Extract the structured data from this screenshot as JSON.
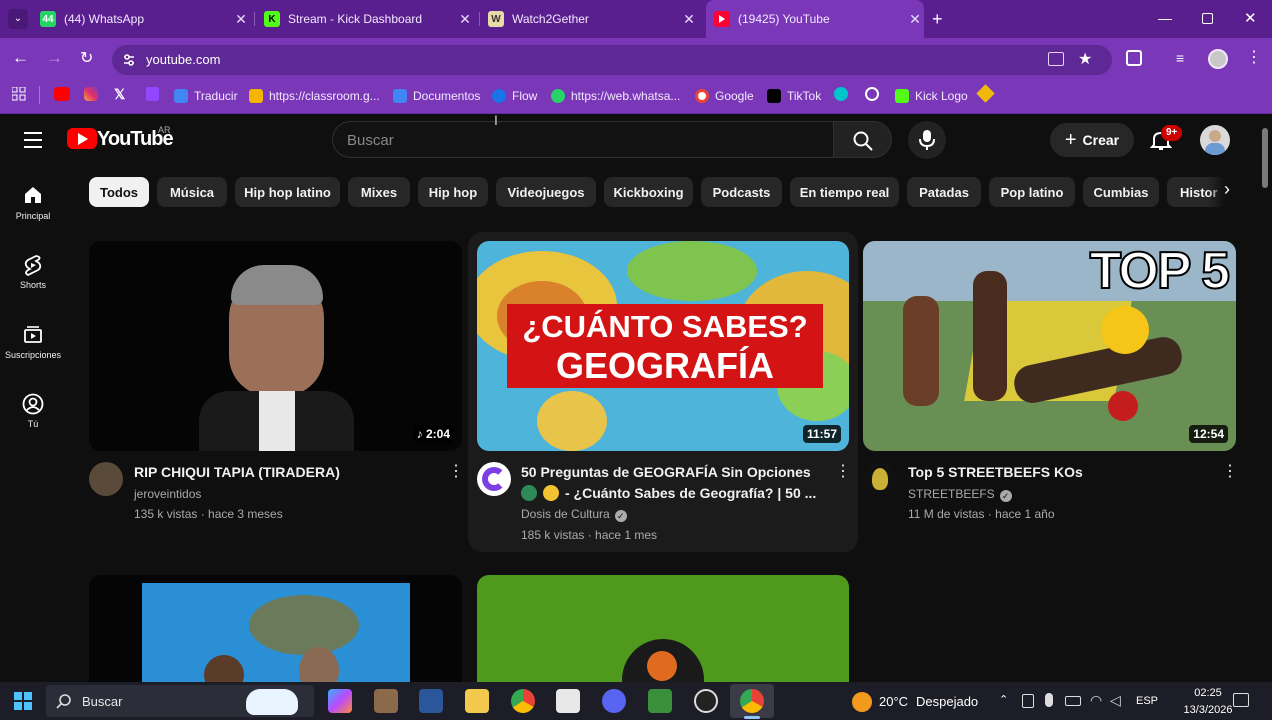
{
  "browser": {
    "tabs": [
      {
        "title": "(44) WhatsApp",
        "badge": "44"
      },
      {
        "title": "Stream - Kick Dashboard",
        "badge": "K"
      },
      {
        "title": "Watch2Gether",
        "badge": "W"
      },
      {
        "title": "(19425) YouTube",
        "badge": ""
      }
    ],
    "url": "youtube.com",
    "bookmarks": [
      {
        "label": "Traducir"
      },
      {
        "label": "https://classroom.g..."
      },
      {
        "label": "Documentos"
      },
      {
        "label": "Flow"
      },
      {
        "label": "https://web.whatsa..."
      },
      {
        "label": "Google"
      },
      {
        "label": "TikTok"
      },
      {
        "label": "Kick Logo"
      }
    ]
  },
  "youtube": {
    "logo_text": "YouTube",
    "region": "AR",
    "search_placeholder": "Buscar",
    "create_label": "Crear",
    "notifications_badge": "9+",
    "sidebar": [
      {
        "label": "Principal"
      },
      {
        "label": "Shorts"
      },
      {
        "label": "Suscripciones"
      },
      {
        "label": "Tú"
      }
    ],
    "chips": [
      "Todos",
      "Música",
      "Hip hop latino",
      "Mixes",
      "Hip hop",
      "Videojuegos",
      "Kickboxing",
      "Podcasts",
      "En tiempo real",
      "Patadas",
      "Pop latino",
      "Cumbias",
      "Histor"
    ],
    "videos": [
      {
        "title": "RIP CHIQUI TAPIA (TIRADERA)",
        "title2": "",
        "channel": "jeroveintidos",
        "verified": false,
        "meta": "135 k vistas · hace 3 meses",
        "duration": "2:04"
      },
      {
        "title": "50 Preguntas de GEOGRAFÍA Sin Opciones",
        "title2": "- ¿Cuánto Sabes de Geografía? | 50 ...",
        "channel": "Dosis de Cultura",
        "verified": true,
        "meta": "185 k vistas · hace 1 mes",
        "duration": "11:57",
        "thumb_line1": "¿CUÁNTO SABES?",
        "thumb_line2": "GEOGRAFÍA"
      },
      {
        "title": "Top 5 STREETBEEFS KOs",
        "title2": "",
        "channel": "STREETBEEFS",
        "verified": true,
        "meta": "11 M de vistas · hace 1 año",
        "duration": "12:54",
        "thumb_text": "TOP 5"
      }
    ]
  },
  "taskbar": {
    "search_placeholder": "Buscar",
    "weather_temp": "20°C",
    "weather_text": "Despejado",
    "language": "ESP",
    "time": "02:25",
    "date": "13/3/2026"
  },
  "colors": {
    "browser_frame": "#5a1f8f",
    "browser_toolbar": "#7a38b8",
    "yt_background": "#0f0f0f",
    "yt_red": "#ff0000",
    "chip_bg": "#272727"
  }
}
